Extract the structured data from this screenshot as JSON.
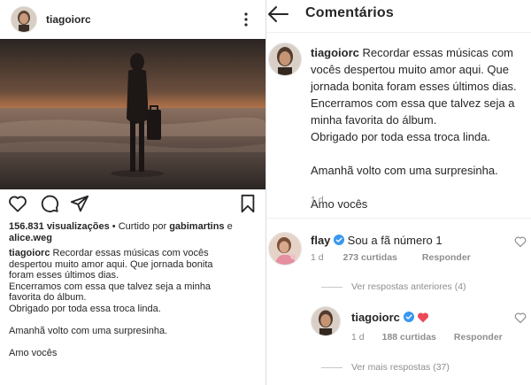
{
  "post": {
    "username": "tiagoiorc",
    "views_count": "156.831 visualizações",
    "liked_by_text": " • Curtido por ",
    "liked_by_user1": "gabimartins",
    "liked_by_and": " e",
    "liked_by_user2": "alice.weg",
    "caption_user": "tiagoiorc",
    "caption_lines": [
      " Recordar essas músicas com vocês",
      "despertou muito amor aqui. Que jornada bonita",
      "foram esses últimos dias.",
      "Encerramos com essa que talvez seja a minha",
      "favorita do álbum.",
      "Obrigado por toda essa troca linda.",
      "",
      "Amanhã volto com uma surpresinha.",
      "",
      "Amo vocês"
    ]
  },
  "comments_screen": {
    "title": "Comentários",
    "main_comment": {
      "username": "tiagoiorc",
      "lines": [
        " Recordar essas músicas com",
        "vocês despertou muito amor aqui. Que",
        "jornada bonita foram esses últimos dias.",
        "Encerramos com essa que talvez seja a",
        "minha favorita do álbum.",
        "Obrigado por toda essa troca linda.",
        "",
        "Amanhã volto com uma surpresinha.",
        "",
        "Amo vocês"
      ],
      "time": "1 d"
    },
    "comment_flay": {
      "username": "flay",
      "text": "Sou a fã número 1",
      "time": "1 d",
      "likes": "273 curtidas",
      "reply": "Responder"
    },
    "view_previous": "Ver respostas anteriores (4)",
    "reply_tiago": {
      "username": "tiagoiorc",
      "time": "1 d",
      "likes": "188 curtidas",
      "reply": "Responder"
    },
    "view_more": "Ver mais respostas (37)"
  },
  "colors": {
    "text": "#262626",
    "muted": "#8e8e8e",
    "verified": "#3897f0",
    "heart_red": "#ed4956"
  }
}
